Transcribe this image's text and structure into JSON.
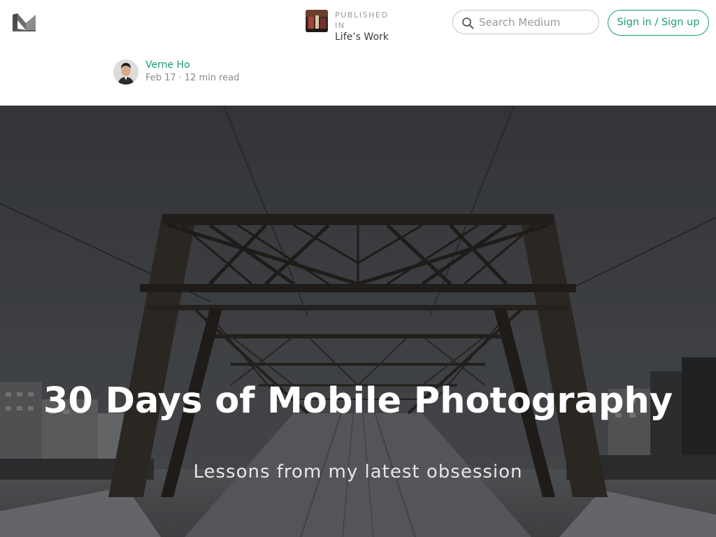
{
  "header": {
    "logo_icon": "medium-logo-icon",
    "publication": {
      "label": "PUBLISHED IN",
      "name": "Life’s Work"
    },
    "search": {
      "placeholder": "Search Medium",
      "icon": "search-icon"
    },
    "signin_label": "Sign in / Sign up"
  },
  "author": {
    "name": "Verne Ho",
    "date": "Feb 17",
    "read_time": "12 min read",
    "separator": "·"
  },
  "hero": {
    "title": "30 Days of Mobile Photography",
    "subtitle": "Lessons from my latest obsession",
    "image": "steel-truss-bridge-photo"
  },
  "colors": {
    "accent": "#1a9e75",
    "muted": "#8a8a8a"
  }
}
